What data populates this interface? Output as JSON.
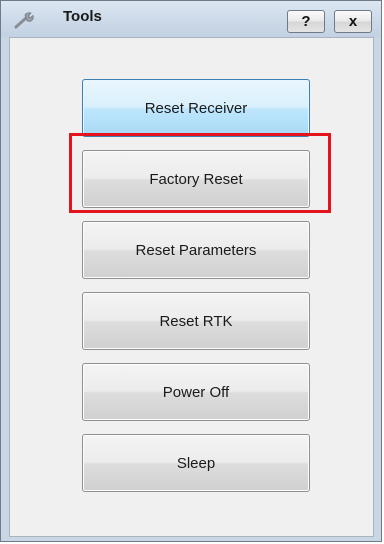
{
  "window": {
    "title": "Tools",
    "help_label": "?",
    "close_label": "x"
  },
  "buttons": [
    {
      "label": "Reset Receiver",
      "state": "focused"
    },
    {
      "label": "Factory Reset",
      "state": "highlighted"
    },
    {
      "label": "Reset Parameters"
    },
    {
      "label": "Reset RTK"
    },
    {
      "label": "Power Off"
    },
    {
      "label": "Sleep"
    }
  ],
  "colors": {
    "highlight": "#e3141b",
    "focus_accent": "#3c7fb1"
  },
  "icons": {
    "title": "wrench-icon"
  }
}
